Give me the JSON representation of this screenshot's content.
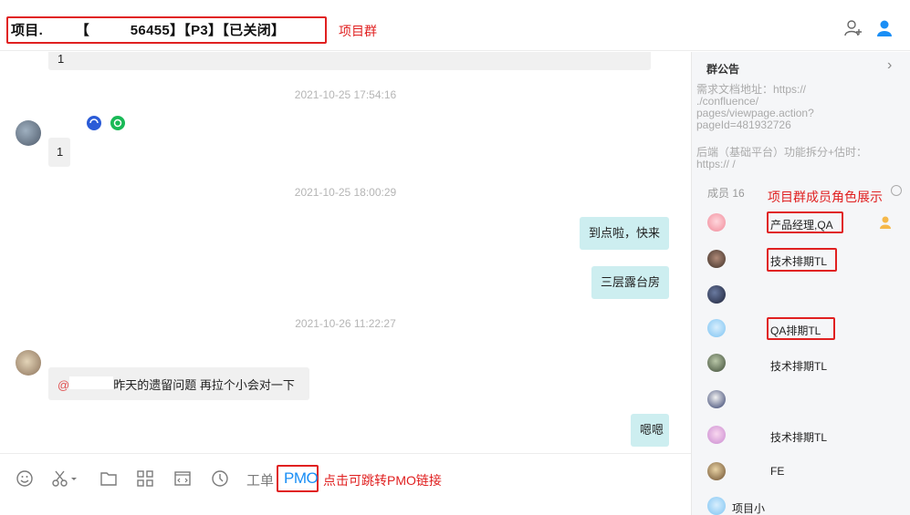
{
  "header": {
    "title": "项目.        【          56455】【P3】【已关闭】",
    "annotation": "项目群"
  },
  "chat": {
    "items": [
      {
        "type": "bubble",
        "text": "1"
      },
      {
        "type": "time",
        "text": "2021-10-25 17:54:16"
      },
      {
        "type": "bubble",
        "text": "1"
      },
      {
        "type": "time",
        "text": "2021-10-25 18:00:29"
      },
      {
        "type": "bubble",
        "text": "到点啦，快来"
      },
      {
        "type": "bubble",
        "text": "三层露台房"
      },
      {
        "type": "time",
        "text": "2021-10-26 11:22:27"
      },
      {
        "type": "mention",
        "at": "@",
        "text": "昨天的遗留问题 再拉个小会对一下"
      },
      {
        "type": "bubble",
        "text": "嗯嗯"
      }
    ]
  },
  "toolbar": {
    "emoji_icon": "smile-icon",
    "scissors_icon": "scissors-icon",
    "folder_icon": "folder-icon",
    "apps_icon": "grid-icon",
    "code_icon": "code-icon",
    "history_icon": "clock-icon",
    "ticket_label": "工单",
    "pmo_label": "PMO",
    "pmo_annotation": "点击可跳转PMO链接"
  },
  "panel": {
    "notice_title": "群公告",
    "notice_lines": [
      "需求文档地址：https://",
      "                          ./confluence/",
      "pages/viewpage.action?",
      "pageId=481932726",
      "后端（基础平台）功能拆分+估时：",
      "https://                                   /"
    ],
    "members_label": "成员 16",
    "members_annotation": "项目群成员角色展示",
    "members": [
      {
        "role": "产品经理,QA"
      },
      {
        "role": "技术排期TL"
      },
      {
        "role": ""
      },
      {
        "role": "QA排期TL"
      },
      {
        "role": "技术排期TL"
      },
      {
        "role": ""
      },
      {
        "role": "技术排期TL"
      },
      {
        "role": "FE"
      },
      {
        "role": "项目小"
      }
    ]
  },
  "colors": {
    "accent_blue": "#1a8ef5",
    "annotation_red": "#e02020",
    "my_bubble": "#cdeef0",
    "other_bubble": "#f0f0f0"
  }
}
